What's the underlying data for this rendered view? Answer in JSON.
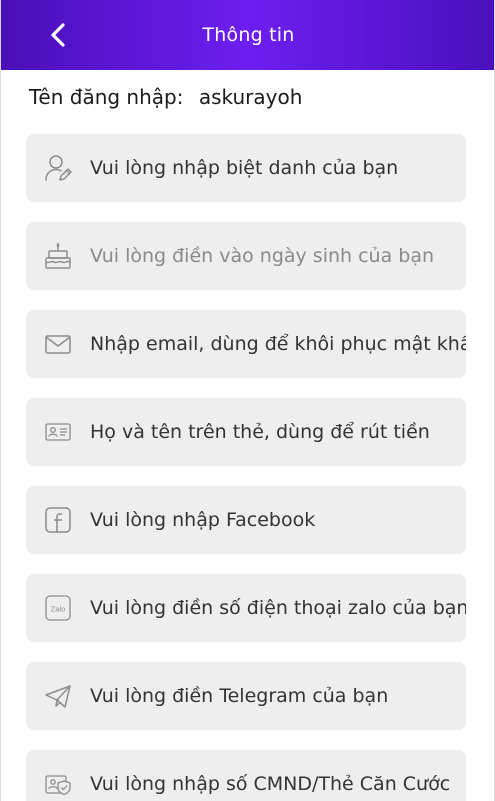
{
  "header": {
    "title": "Thông tin",
    "back_icon": "chevron-left-icon",
    "gradient": [
      "#4a0fb8",
      "#6d1ef0",
      "#4a10bb"
    ]
  },
  "account": {
    "username_label": "Tên đăng nhập:",
    "username_value": "askurayoh"
  },
  "fields": [
    {
      "icon": "user-edit-icon",
      "placeholder": "Vui lòng nhập biệt danh của bạn"
    },
    {
      "icon": "birthday-cake-icon",
      "placeholder": "Vui lòng điền vào ngày sinh của bạn"
    },
    {
      "icon": "mail-icon",
      "placeholder": "Nhập email, dùng để khôi phục mật khẩu"
    },
    {
      "icon": "id-card-icon",
      "placeholder": "Họ và tên trên thẻ, dùng để rút tiền"
    },
    {
      "icon": "facebook-icon",
      "placeholder": "Vui lòng nhập Facebook"
    },
    {
      "icon": "zalo-icon",
      "placeholder": "Vui lòng điền số điện thoại zalo của bạn",
      "icon_text": "Zalo"
    },
    {
      "icon": "telegram-icon",
      "placeholder": "Vui lòng điền Telegram của bạn"
    },
    {
      "icon": "id-shield-icon",
      "placeholder": "Vui lòng nhập số CMND/Thẻ Căn Cước"
    }
  ],
  "colors": {
    "field_bg": "#eeeeef",
    "placeholder_text": "#333333",
    "muted_text": "#8a8a8a",
    "icon_stroke": "#8c8c8c"
  }
}
